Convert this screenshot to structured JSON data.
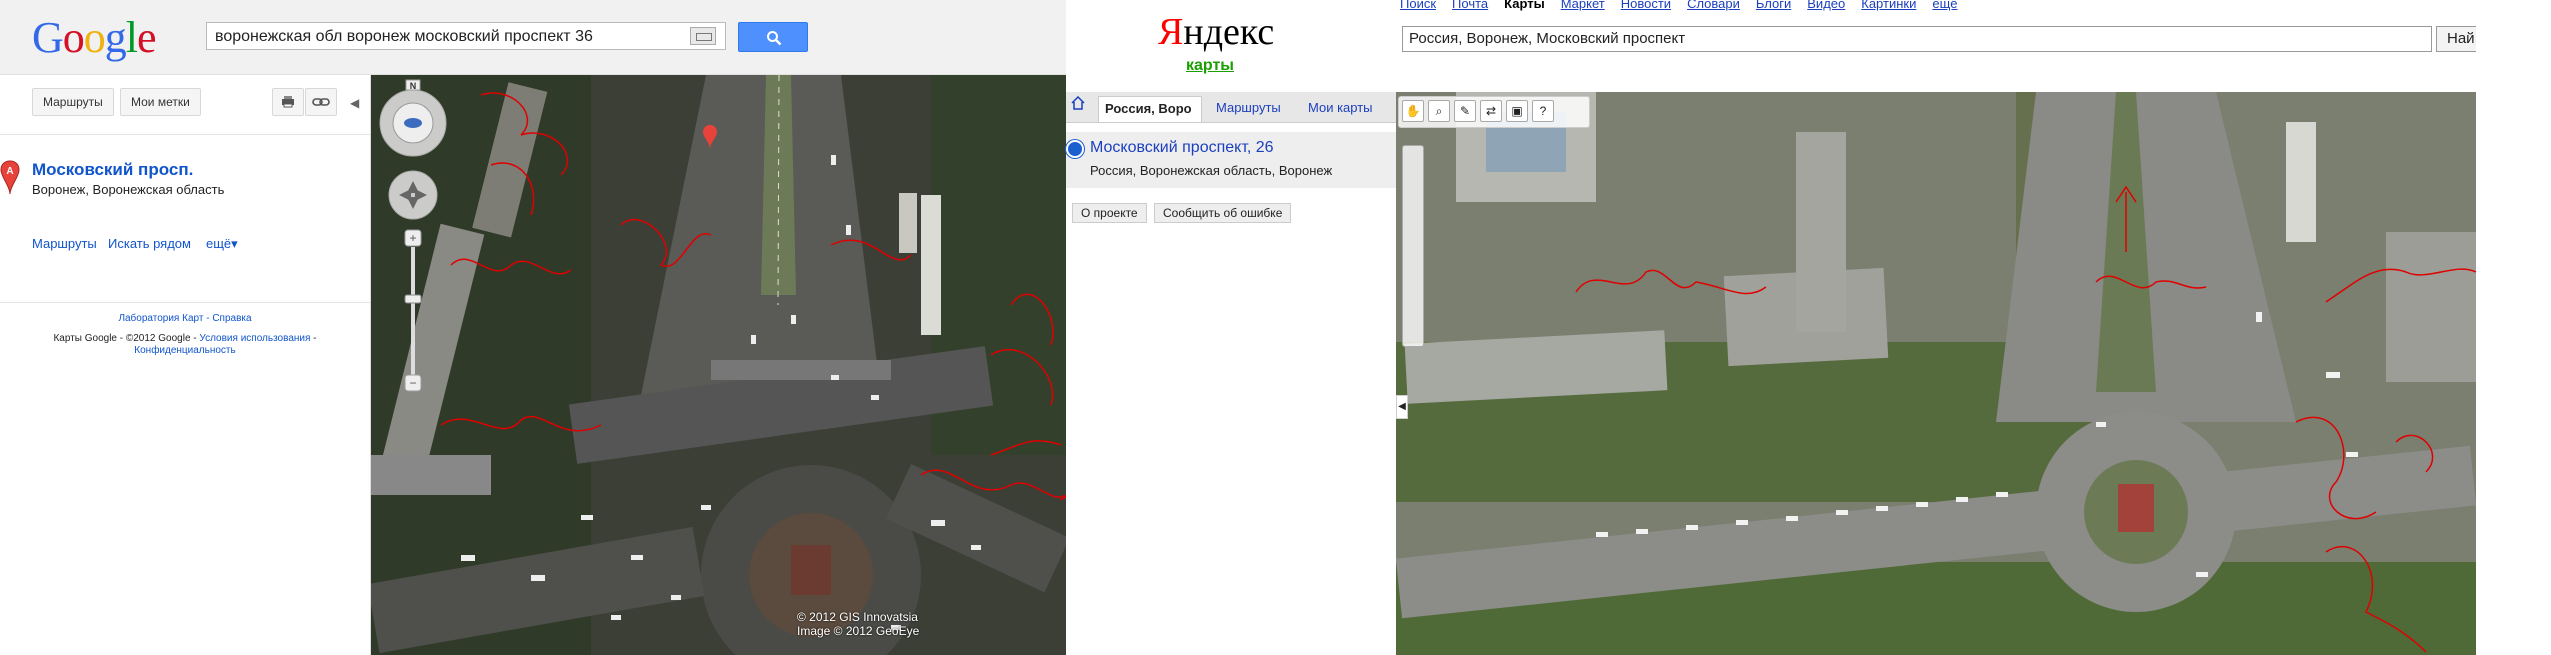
{
  "google": {
    "logo": "Google",
    "search": {
      "value": "воронежская обл воронеж московский проспект 36"
    },
    "toolbar": {
      "routes_label": "Маршруты",
      "mymaps_label": "Мои метки"
    },
    "place": {
      "marker_letter": "A",
      "name": "Московский просп.",
      "address": "Воронеж, Воронежская область"
    },
    "actions": {
      "routes": "Маршруты",
      "nearby": "Искать рядом",
      "more": "ещё▾"
    },
    "footer": {
      "labs": "Лаборатория Карт - Справка",
      "copyright": "Карты Google - ©2012 Google -",
      "terms": "Условия использования",
      "privacy": "Конфиденциальность"
    },
    "map": {
      "compass_letter": "N",
      "copyright_line1": "© 2012 GIS Innovatsia",
      "copyright_line2": "Image © 2012 GeoEye"
    }
  },
  "yandex": {
    "logo_first": "Я",
    "logo_rest": "ндекс",
    "service": "карты",
    "nav": [
      "Поиск",
      "Почта",
      "Карты",
      "Маркет",
      "Новости",
      "Словари",
      "Блоги",
      "Видео",
      "Картинки",
      "ещё"
    ],
    "nav_active": "Карты",
    "search": {
      "value": "Россия, Воронеж, Московский проспект"
    },
    "find_button": "Най",
    "tabs": {
      "active": "Россия, Воро",
      "routes": "Маршруты",
      "mymaps": "Мои карты"
    },
    "result": {
      "name": "Московский проспект, 26",
      "address": "Россия, Воронежская область, Воронеж"
    },
    "buttons": {
      "about": "О проекте",
      "report": "Сообщить об ошибке"
    }
  },
  "colors": {
    "google_blue": "#4d90fe",
    "google_link": "#1155cc",
    "yandex_link": "#1c3fbe",
    "yandex_red": "#ff0000",
    "annotation_red": "#e00000"
  }
}
